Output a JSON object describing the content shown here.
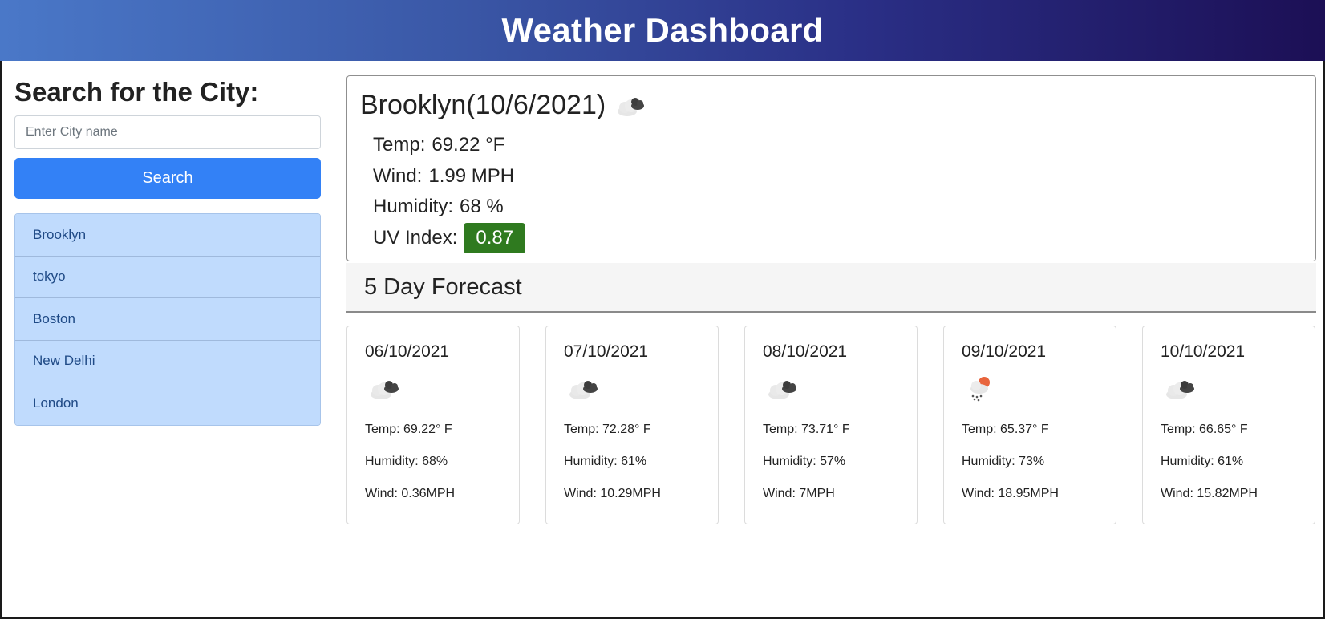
{
  "header": {
    "title": "Weather Dashboard"
  },
  "sidebar": {
    "heading": "Search for the City:",
    "input_placeholder": "Enter City name",
    "input_value": "",
    "search_label": "Search",
    "history": [
      "Brooklyn",
      "tokyo",
      "Boston",
      "New Delhi",
      "London"
    ]
  },
  "current": {
    "title": "Brooklyn(10/6/2021)",
    "icon": "broken-clouds-icon",
    "temp_label": "Temp:",
    "temp_value": "69.22 °F",
    "wind_label": "Wind:",
    "wind_value": "1.99 MPH",
    "humidity_label": "Humidity:",
    "humidity_value": "68 %",
    "uv_label": "UV Index:",
    "uv_value": "0.87"
  },
  "forecast": {
    "heading": "5 Day Forecast",
    "days": [
      {
        "date": "06/10/2021",
        "icon": "broken-clouds-icon",
        "temp": "Temp: 69.22° F",
        "humidity": "Humidity: 68%",
        "wind": "Wind: 0.36MPH"
      },
      {
        "date": "07/10/2021",
        "icon": "broken-clouds-icon",
        "temp": "Temp: 72.28° F",
        "humidity": "Humidity: 61%",
        "wind": "Wind: 10.29MPH"
      },
      {
        "date": "08/10/2021",
        "icon": "broken-clouds-icon",
        "temp": "Temp: 73.71° F",
        "humidity": "Humidity: 57%",
        "wind": "Wind: 7MPH"
      },
      {
        "date": "09/10/2021",
        "icon": "rain-sun-icon",
        "temp": "Temp: 65.37° F",
        "humidity": "Humidity: 73%",
        "wind": "Wind: 18.95MPH"
      },
      {
        "date": "10/10/2021",
        "icon": "broken-clouds-icon",
        "temp": "Temp: 66.65° F",
        "humidity": "Humidity: 61%",
        "wind": "Wind: 15.82MPH"
      }
    ]
  },
  "colors": {
    "header_gradient_start": "#4a78c8",
    "header_gradient_end": "#1c0f55",
    "search_button": "#3381f6",
    "history_bg": "#c0dbfd",
    "uv_badge": "#2f7a1f"
  }
}
